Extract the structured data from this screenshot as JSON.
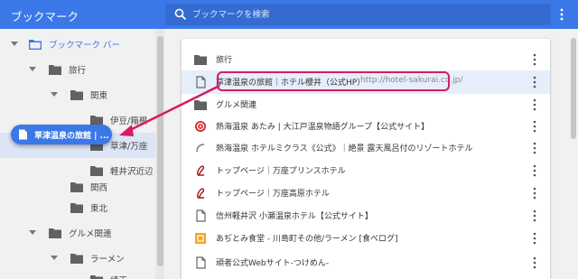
{
  "header": {
    "title": "ブックマーク",
    "search_placeholder": "ブックマークを検索"
  },
  "sidebar": {
    "items": [
      {
        "label": "ブックマーク バー"
      },
      {
        "label": "旅行"
      },
      {
        "label": "関東"
      },
      {
        "label": "伊豆/箱根"
      },
      {
        "label": "草津/万座"
      },
      {
        "label": "軽井沢近辺"
      },
      {
        "label": "関西"
      },
      {
        "label": "東北"
      },
      {
        "label": "グルメ関連"
      },
      {
        "label": "ラーメン"
      },
      {
        "label": "埼玉"
      }
    ]
  },
  "drag": {
    "label": "草津温泉の旅館 | ..."
  },
  "list": {
    "items": [
      {
        "title": "旅行",
        "url": "",
        "icon": "folder-icon"
      },
      {
        "title": "草津温泉の旅館｜ホテル櫻井（公式HP）",
        "url": "http://hotel-sakurai.co.jp/",
        "icon": "page-icon"
      },
      {
        "title": "グルメ関連",
        "url": "",
        "icon": "folder-icon"
      },
      {
        "title": "熱海温泉 あたみ | 大江戸温泉物語グループ【公式サイト】",
        "url": "",
        "icon": "oedo-logo-icon"
      },
      {
        "title": "熱海温泉 ホテルミクラス《公式》｜絶景 露天風呂付のリゾートホテル",
        "url": "",
        "icon": "mikuras-logo-icon"
      },
      {
        "title": "トップページ｜万座プリンスホテル",
        "url": "",
        "icon": "prince-logo-icon"
      },
      {
        "title": "トップページ｜万座高原ホテル",
        "url": "",
        "icon": "prince-logo-icon"
      },
      {
        "title": "信州軽井沢 小瀬温泉ホテル【公式サイト】",
        "url": "",
        "icon": "page-icon"
      },
      {
        "title": "あぢとみ食堂 - 川島町その他/ラーメン [食べログ]",
        "url": "",
        "icon": "tabelog-logo-icon"
      },
      {
        "title": "頑者公式Webサイト-つけめん-",
        "url": "",
        "icon": "page-icon"
      }
    ]
  },
  "colors": {
    "accent": "#3b78e7",
    "highlight_border": "#d81b60",
    "folder": "#616161"
  }
}
